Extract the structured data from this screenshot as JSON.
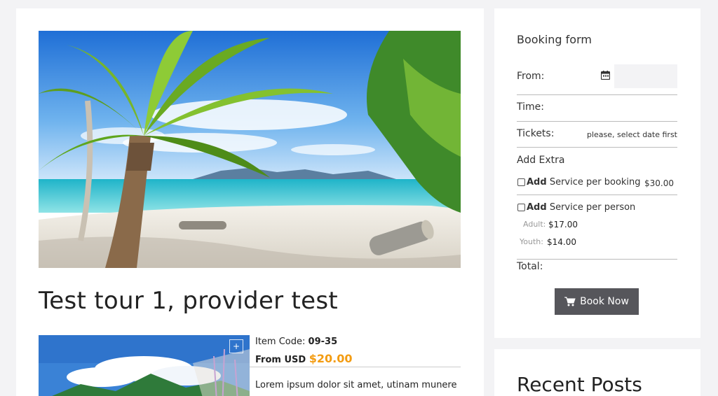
{
  "tour": {
    "title": "Test tour 1, provider test",
    "item_code_label": "Item Code:",
    "item_code": "09-35",
    "from_label": "From USD",
    "price": "$20.00",
    "description": "Lorem ipsum dolor sit amet, utinam munere"
  },
  "booking": {
    "title": "Booking form",
    "from_label": "From:",
    "date_placeholder": "",
    "time_label": "Time:",
    "tickets_label": "Tickets:",
    "tickets_msg": "please, select date first",
    "add_extra_label": "Add Extra",
    "extras": [
      {
        "add": "Add",
        "label": "Service per booking",
        "price": "$30.00"
      },
      {
        "add": "Add",
        "label": "Service per person"
      }
    ],
    "person_prices": [
      {
        "label": "Adult:",
        "price": "$17.00"
      },
      {
        "label": "Youth:",
        "price": "$14.00"
      }
    ],
    "total_label": "Total:",
    "book_button": "Book Now"
  },
  "sidebar": {
    "recent_posts_title": "Recent Posts"
  },
  "icons": {
    "calendar": "calendar-icon",
    "cart": "cart-icon",
    "zoom": "plus-icon"
  },
  "colors": {
    "price_accent": "#f39c12",
    "button_bg": "#56565b"
  }
}
